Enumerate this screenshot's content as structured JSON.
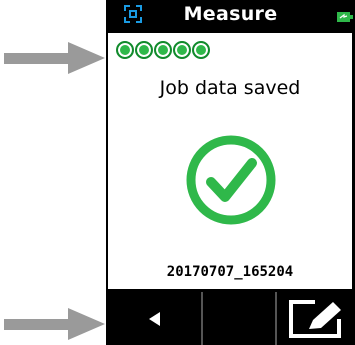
{
  "header": {
    "title": "Measure",
    "app_icon": "target-crosshair-icon",
    "battery_icon": "battery-icon"
  },
  "progress": {
    "completed": 5,
    "total": 5
  },
  "status": {
    "message": "Job data saved",
    "icon": "check-circle-icon",
    "job_id": "20170707_165204"
  },
  "softkeys": {
    "left": "back-arrow-icon",
    "middle": "",
    "right": "edit-icon"
  },
  "colors": {
    "accent_green": "#2fb84a",
    "header_blue": "#1a9be3",
    "pointer_gray": "#9a9a9a"
  }
}
